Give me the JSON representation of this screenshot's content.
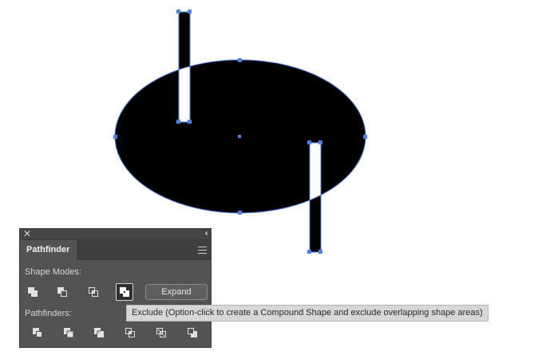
{
  "panel": {
    "close_glyph": "✕",
    "collapse_glyph": "‹‹",
    "tab_label": "Pathfinder",
    "shape_modes_label": "Shape Modes:",
    "pathfinders_label": "Pathfinders:",
    "expand_label": "Expand",
    "shape_mode_buttons": [
      {
        "name": "unite-icon",
        "active": false
      },
      {
        "name": "minus-front-icon",
        "active": false
      },
      {
        "name": "intersect-icon",
        "active": false
      },
      {
        "name": "exclude-icon",
        "active": true
      }
    ],
    "pathfinder_buttons": [
      {
        "name": "divide-icon"
      },
      {
        "name": "trim-icon"
      },
      {
        "name": "merge-icon"
      },
      {
        "name": "crop-icon"
      },
      {
        "name": "outline-icon"
      },
      {
        "name": "minus-back-icon"
      }
    ]
  },
  "tooltip": {
    "text": "Exclude (Option-click to create a Compound Shape and exclude overlapping shape areas)"
  },
  "colors": {
    "selection": "#4f7fe0",
    "shape_fill": "#000000",
    "panel_bg": "#535353"
  }
}
